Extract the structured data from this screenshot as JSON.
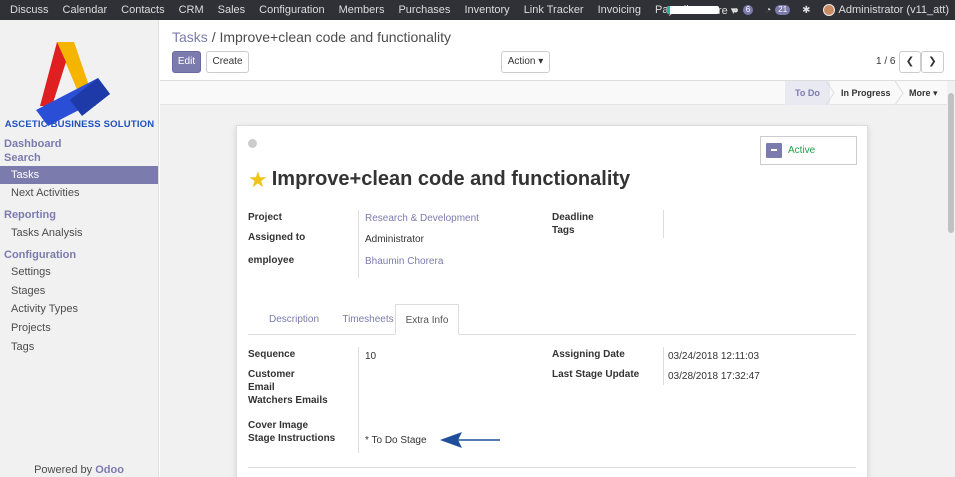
{
  "topbar": {
    "menu": [
      "Discuss",
      "Calendar",
      "Contacts",
      "CRM",
      "Sales",
      "Configuration",
      "Members",
      "Purchases",
      "Inventory",
      "Link Tracker",
      "Invoicing",
      "Payroll",
      "More ▾"
    ],
    "progress_fraction": 0.06,
    "chat_badge": "6",
    "activity_badge": "21",
    "user": "Administrator (v11_att)"
  },
  "sidebar": {
    "logo_text": "ASCETIC BUSINESS SOLUTION",
    "dashboard": "Dashboard",
    "search": "Search",
    "tasks": "Tasks",
    "next_activities": "Next Activities",
    "reporting": "Reporting",
    "tasks_analysis": "Tasks Analysis",
    "configuration": "Configuration",
    "settings": "Settings",
    "stages": "Stages",
    "activity_types": "Activity Types",
    "projects": "Projects",
    "tags": "Tags",
    "powered_by": "Powered by",
    "odoo": "Odoo"
  },
  "control": {
    "breadcrumb_parent": "Tasks",
    "breadcrumb_sep": "/",
    "breadcrumb_current": "Improve+clean code and functionality",
    "edit": "Edit",
    "create": "Create",
    "action": "Action ▾",
    "pager": "1 / 6",
    "prev": "❮",
    "next": "❯"
  },
  "statusbar": {
    "todo": "To Do",
    "in_progress": "In Progress",
    "more": "More ▾"
  },
  "form": {
    "active": "Active",
    "title": "Improve+clean code and functionality",
    "project_label": "Project",
    "project_value": "Research & Development",
    "assigned_label": "Assigned to",
    "assigned_value": "Administrator",
    "employee_label": "employee",
    "employee_value": "Bhaumin Chorera",
    "deadline_label": "Deadline",
    "tags_label": "Tags",
    "tabs": [
      "Description",
      "Timesheets",
      "Extra Info"
    ],
    "sequence_label": "Sequence",
    "sequence_value": "10",
    "customer_label": "Customer",
    "email_label": "Email",
    "watchers_label": "Watchers Emails",
    "cover_label": "Cover Image",
    "stage_instr_label": "Stage Instructions",
    "stage_instr_value": "* To Do Stage",
    "assigning_date_label": "Assigning Date",
    "assigning_date_value": "03/24/2018 12:11:03",
    "last_stage_label": "Last Stage Update",
    "last_stage_value": "03/28/2018 17:32:47"
  },
  "colors": {
    "brand": "#7c7bad",
    "navbar": "#2f3136",
    "active_green": "#21a14a",
    "star": "#f0c419",
    "arrow": "#1f4f9a"
  }
}
